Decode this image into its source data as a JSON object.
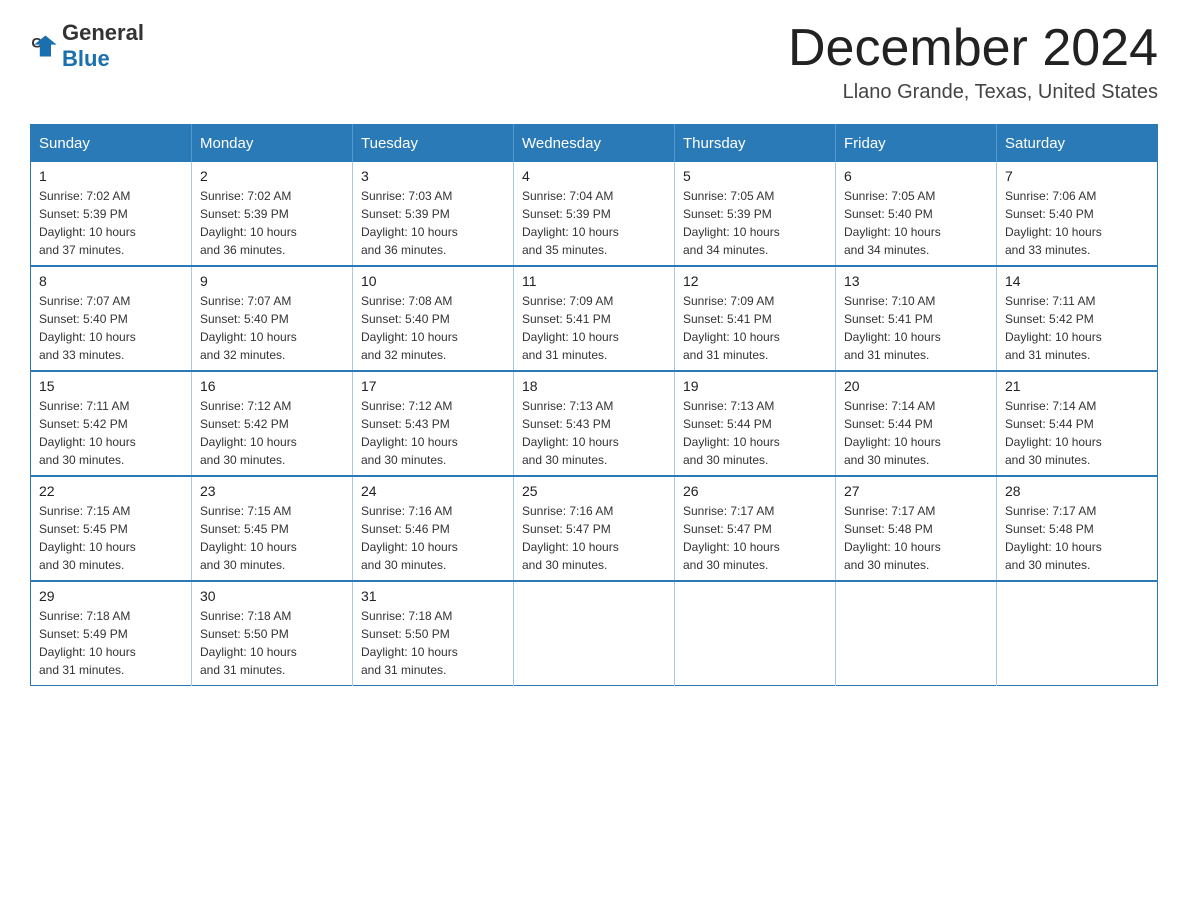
{
  "logo": {
    "text_general": "General",
    "text_blue": "Blue"
  },
  "title": {
    "month": "December 2024",
    "location": "Llano Grande, Texas, United States"
  },
  "weekdays": [
    "Sunday",
    "Monday",
    "Tuesday",
    "Wednesday",
    "Thursday",
    "Friday",
    "Saturday"
  ],
  "weeks": [
    [
      {
        "day": "1",
        "sunrise": "7:02 AM",
        "sunset": "5:39 PM",
        "daylight": "10 hours and 37 minutes."
      },
      {
        "day": "2",
        "sunrise": "7:02 AM",
        "sunset": "5:39 PM",
        "daylight": "10 hours and 36 minutes."
      },
      {
        "day": "3",
        "sunrise": "7:03 AM",
        "sunset": "5:39 PM",
        "daylight": "10 hours and 36 minutes."
      },
      {
        "day": "4",
        "sunrise": "7:04 AM",
        "sunset": "5:39 PM",
        "daylight": "10 hours and 35 minutes."
      },
      {
        "day": "5",
        "sunrise": "7:05 AM",
        "sunset": "5:39 PM",
        "daylight": "10 hours and 34 minutes."
      },
      {
        "day": "6",
        "sunrise": "7:05 AM",
        "sunset": "5:40 PM",
        "daylight": "10 hours and 34 minutes."
      },
      {
        "day": "7",
        "sunrise": "7:06 AM",
        "sunset": "5:40 PM",
        "daylight": "10 hours and 33 minutes."
      }
    ],
    [
      {
        "day": "8",
        "sunrise": "7:07 AM",
        "sunset": "5:40 PM",
        "daylight": "10 hours and 33 minutes."
      },
      {
        "day": "9",
        "sunrise": "7:07 AM",
        "sunset": "5:40 PM",
        "daylight": "10 hours and 32 minutes."
      },
      {
        "day": "10",
        "sunrise": "7:08 AM",
        "sunset": "5:40 PM",
        "daylight": "10 hours and 32 minutes."
      },
      {
        "day": "11",
        "sunrise": "7:09 AM",
        "sunset": "5:41 PM",
        "daylight": "10 hours and 31 minutes."
      },
      {
        "day": "12",
        "sunrise": "7:09 AM",
        "sunset": "5:41 PM",
        "daylight": "10 hours and 31 minutes."
      },
      {
        "day": "13",
        "sunrise": "7:10 AM",
        "sunset": "5:41 PM",
        "daylight": "10 hours and 31 minutes."
      },
      {
        "day": "14",
        "sunrise": "7:11 AM",
        "sunset": "5:42 PM",
        "daylight": "10 hours and 31 minutes."
      }
    ],
    [
      {
        "day": "15",
        "sunrise": "7:11 AM",
        "sunset": "5:42 PM",
        "daylight": "10 hours and 30 minutes."
      },
      {
        "day": "16",
        "sunrise": "7:12 AM",
        "sunset": "5:42 PM",
        "daylight": "10 hours and 30 minutes."
      },
      {
        "day": "17",
        "sunrise": "7:12 AM",
        "sunset": "5:43 PM",
        "daylight": "10 hours and 30 minutes."
      },
      {
        "day": "18",
        "sunrise": "7:13 AM",
        "sunset": "5:43 PM",
        "daylight": "10 hours and 30 minutes."
      },
      {
        "day": "19",
        "sunrise": "7:13 AM",
        "sunset": "5:44 PM",
        "daylight": "10 hours and 30 minutes."
      },
      {
        "day": "20",
        "sunrise": "7:14 AM",
        "sunset": "5:44 PM",
        "daylight": "10 hours and 30 minutes."
      },
      {
        "day": "21",
        "sunrise": "7:14 AM",
        "sunset": "5:44 PM",
        "daylight": "10 hours and 30 minutes."
      }
    ],
    [
      {
        "day": "22",
        "sunrise": "7:15 AM",
        "sunset": "5:45 PM",
        "daylight": "10 hours and 30 minutes."
      },
      {
        "day": "23",
        "sunrise": "7:15 AM",
        "sunset": "5:45 PM",
        "daylight": "10 hours and 30 minutes."
      },
      {
        "day": "24",
        "sunrise": "7:16 AM",
        "sunset": "5:46 PM",
        "daylight": "10 hours and 30 minutes."
      },
      {
        "day": "25",
        "sunrise": "7:16 AM",
        "sunset": "5:47 PM",
        "daylight": "10 hours and 30 minutes."
      },
      {
        "day": "26",
        "sunrise": "7:17 AM",
        "sunset": "5:47 PM",
        "daylight": "10 hours and 30 minutes."
      },
      {
        "day": "27",
        "sunrise": "7:17 AM",
        "sunset": "5:48 PM",
        "daylight": "10 hours and 30 minutes."
      },
      {
        "day": "28",
        "sunrise": "7:17 AM",
        "sunset": "5:48 PM",
        "daylight": "10 hours and 30 minutes."
      }
    ],
    [
      {
        "day": "29",
        "sunrise": "7:18 AM",
        "sunset": "5:49 PM",
        "daylight": "10 hours and 31 minutes."
      },
      {
        "day": "30",
        "sunrise": "7:18 AM",
        "sunset": "5:50 PM",
        "daylight": "10 hours and 31 minutes."
      },
      {
        "day": "31",
        "sunrise": "7:18 AM",
        "sunset": "5:50 PM",
        "daylight": "10 hours and 31 minutes."
      },
      null,
      null,
      null,
      null
    ]
  ],
  "labels": {
    "sunrise": "Sunrise:",
    "sunset": "Sunset:",
    "daylight": "Daylight:"
  }
}
